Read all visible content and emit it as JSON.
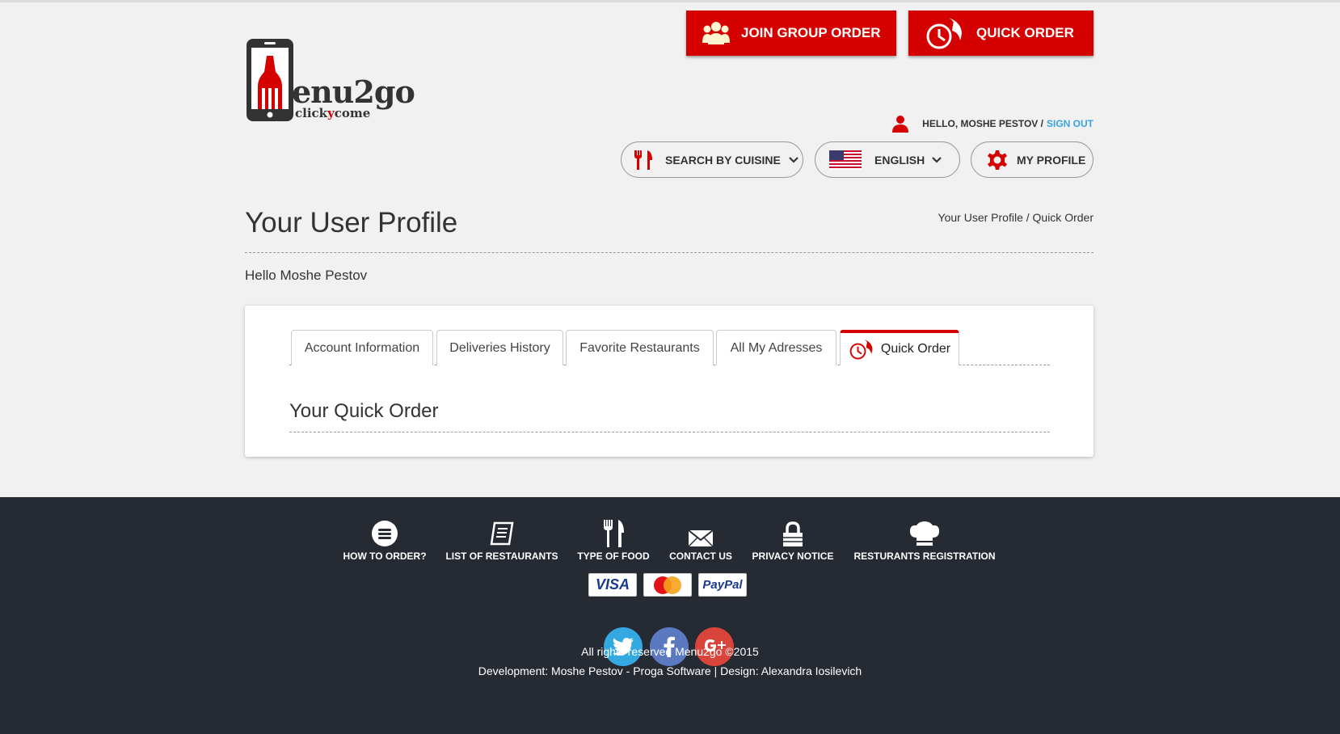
{
  "header": {
    "logo_main": "enu2go",
    "logo_sub_1": "click",
    "logo_sub_2": "y",
    "logo_sub_3": "come",
    "join_group_order": "JOIN GROUP ORDER",
    "quick_order": "QUICK ORDER",
    "hello_user": "HELLO, MOSHE PESTOV /",
    "sign_out": "SIGN OUT",
    "search_cuisine": "SEARCH BY CUISINE",
    "language": "ENGLISH",
    "my_profile": "MY PROFILE"
  },
  "page": {
    "title": "Your User Profile",
    "breadcrumb": "Your User Profile / Quick Order",
    "greeting": "Hello Moshe Pestov"
  },
  "tabs": [
    {
      "label": "Account Information"
    },
    {
      "label": "Deliveries History"
    },
    {
      "label": "Favorite Restaurants"
    },
    {
      "label": "All My Adresses"
    },
    {
      "label": "Quick Order"
    }
  ],
  "card": {
    "title": "Your Quick Order"
  },
  "footer": {
    "nav": [
      {
        "label": "HOW TO ORDER?",
        "icon": "menu-circle-icon"
      },
      {
        "label": "LIST OF RESTAURANTS",
        "icon": "list-document-icon"
      },
      {
        "label": "TYPE OF FOOD",
        "icon": "cutlery-icon"
      },
      {
        "label": "CONTACT US",
        "icon": "envelope-icon"
      },
      {
        "label": "PRIVACY NOTICE",
        "icon": "lock-icon"
      },
      {
        "label": "RESTURANTS REGISTRATION",
        "icon": "chef-hat-icon"
      }
    ],
    "payments": [
      "VISA",
      "PayPal"
    ],
    "copyright": "All rights reserved Menu2go ©2015",
    "credits": "Development: Moshe Pestov - Proga Software | Design: Alexandra Iosilevich"
  },
  "colors": {
    "brand_red": "#d50000",
    "footer_bg": "#262b33",
    "link_blue": "#3aa3e3",
    "twitter": "#34a9e1",
    "facebook": "#5b79c0",
    "google_plus": "#d9453a"
  }
}
